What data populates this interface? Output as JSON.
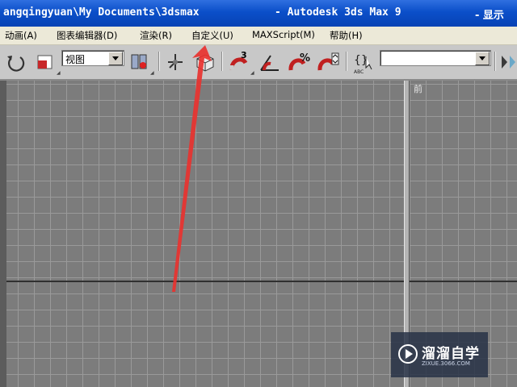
{
  "window": {
    "path": "angqingyuan\\My Documents\\3dsmax",
    "app_title": "- Autodesk 3ds Max 9",
    "right_text": "- 显示"
  },
  "menu": {
    "items": [
      "动画(A)",
      "图表编辑器(D)",
      "渲染(R)",
      "自定义(U)",
      "MAXScript(M)",
      "帮助(H)"
    ]
  },
  "toolbar": {
    "reference_coord": "视图",
    "named_selection": "",
    "angle_snap_label": "3"
  },
  "viewport": {
    "front_label": "前"
  },
  "watermark": {
    "name": "溜溜自学",
    "url": "ZIXUE.3066.COM"
  },
  "colors": {
    "titlebar": "#0b4fc9",
    "arrow": "#e8322f",
    "viewport": "#7c7c7c"
  }
}
